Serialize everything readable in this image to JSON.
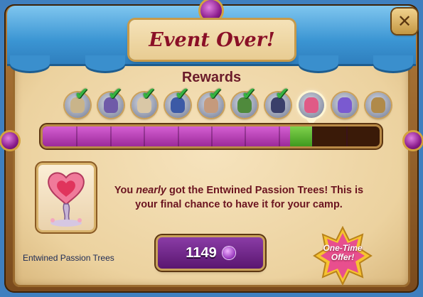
{
  "dialog": {
    "title": "Event Over!",
    "close_icon": "close-icon",
    "rewards_label": "Rewards"
  },
  "rewards": [
    {
      "name": "reward-1",
      "claimed": true,
      "color": "#c9b48a"
    },
    {
      "name": "reward-2",
      "claimed": true,
      "color": "#6f5aa8"
    },
    {
      "name": "reward-3",
      "claimed": true,
      "color": "#d9c7a6"
    },
    {
      "name": "reward-4",
      "claimed": true,
      "color": "#3c5aa6"
    },
    {
      "name": "reward-5",
      "claimed": true,
      "color": "#c59a7c"
    },
    {
      "name": "reward-6",
      "claimed": true,
      "color": "#4f8a3c"
    },
    {
      "name": "reward-7",
      "claimed": true,
      "color": "#3a3f6a"
    },
    {
      "name": "reward-8",
      "claimed": false,
      "color": "#e05a86",
      "current": true
    },
    {
      "name": "reward-9",
      "claimed": false,
      "color": "#7a5ad0"
    },
    {
      "name": "reward-10",
      "claimed": false,
      "color": "#b08a4a"
    }
  ],
  "progress": {
    "segments": 10,
    "filled_fraction": 0.735,
    "recent_fraction": 0.065,
    "fill_color": "#b33cb0",
    "recent_color": "#5cb52f"
  },
  "item": {
    "name": "Entwined Passion Trees"
  },
  "message": {
    "before": "You ",
    "emphasis": "nearly",
    "after": " got the Entwined Passion Trees! This is your final chance to have it for your camp."
  },
  "purchase": {
    "price": "1149",
    "currency_icon": "gem-icon"
  },
  "offer": {
    "line1": "One-Time",
    "line2": "Offer!"
  }
}
